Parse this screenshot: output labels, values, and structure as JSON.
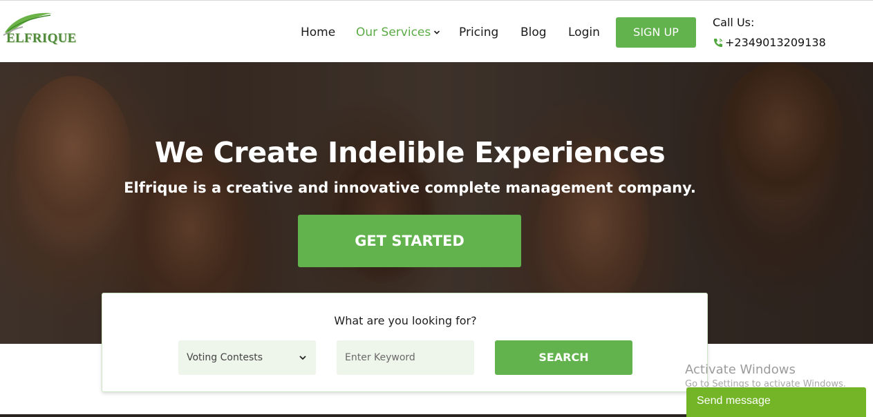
{
  "header": {
    "logo_text": "ELFRIQUE",
    "nav": [
      {
        "label": "Home"
      },
      {
        "label": "Our Services",
        "active": true
      },
      {
        "label": "Pricing"
      },
      {
        "label": "Blog"
      },
      {
        "label": "Login"
      }
    ],
    "signup_label": "SIGN UP",
    "call_label": "Call Us:",
    "phone": "+2349013209138"
  },
  "hero": {
    "title": "We Create Indelible Experiences",
    "subtitle": "Elfrique is a creative and innovative complete management company.",
    "cta_label": "GET STARTED"
  },
  "search": {
    "question": "What are you looking for?",
    "category_selected": "Voting Contests",
    "keyword_placeholder": "Enter Keyword",
    "button_label": "SEARCH"
  },
  "windows_watermark": {
    "title": "Activate Windows",
    "subtitle": "Go to Settings to activate Windows."
  },
  "chat_widget": {
    "label": "Send message"
  },
  "colors": {
    "brand_green": "#62b24e",
    "nav_active": "#5aab45",
    "chat_green": "#73b526"
  },
  "icons": {
    "nav_dropdown": "chevron-down-icon",
    "phone": "phone-icon",
    "select": "chevron-down-icon"
  }
}
